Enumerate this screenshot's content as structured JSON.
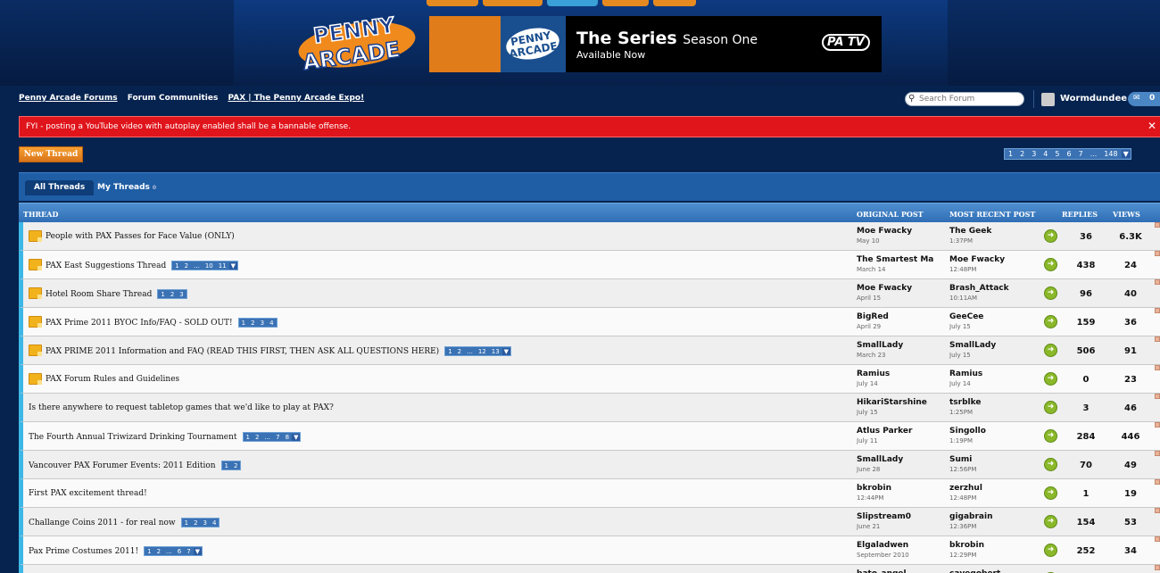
{
  "logo_text": "PENNY ARCADE",
  "banner": {
    "logo_text": "PENNY ARCADE",
    "title": "The Series",
    "title_suffix": "Season One",
    "subtitle": "Available Now",
    "network": "PA TV"
  },
  "breadcrumbs": [
    "Penny Arcade Forums",
    "Forum Communities",
    "PAX | The Penny Arcade Expo!"
  ],
  "search": {
    "placeholder": "Search Forum"
  },
  "user": {
    "name": "Wormdundee",
    "messages": "0"
  },
  "alert": {
    "text": "FYI - posting a YouTube video with autoplay enabled shall be a bannable offense.",
    "close": "✕"
  },
  "new_thread_label": "New Thread",
  "pager": [
    "1",
    "2",
    "3",
    "4",
    "5",
    "6",
    "7",
    "...",
    "148"
  ],
  "tabs": {
    "all": "All Threads",
    "mine": "My Threads",
    "mine_count": "0"
  },
  "columns": {
    "thread": "THREAD",
    "original": "ORIGINAL POST",
    "recent": "MOST RECENT POST",
    "replies": "REPLIES",
    "views": "VIEWS"
  },
  "threads": [
    {
      "sticky": true,
      "title": "People with PAX Passes for Face Value (ONLY)",
      "pages": [],
      "op": "Moe Fwacky",
      "op_date": "May 10",
      "last": "The Geek",
      "last_date": "1:37PM",
      "replies": "36",
      "views": "6.3K"
    },
    {
      "sticky": true,
      "title": "PAX East Suggestions Thread",
      "pages": [
        "1",
        "2",
        "...",
        "10",
        "11"
      ],
      "dropdown": true,
      "op": "The Smartest Ma",
      "op_date": "March 14",
      "last": "Moe Fwacky",
      "last_date": "12:48PM",
      "replies": "438",
      "views": "24"
    },
    {
      "sticky": true,
      "title": "Hotel Room Share Thread",
      "pages": [
        "1",
        "2",
        "3"
      ],
      "op": "Moe Fwacky",
      "op_date": "April 15",
      "last": "Brash_Attack",
      "last_date": "10:11AM",
      "replies": "96",
      "views": "40"
    },
    {
      "sticky": true,
      "title": "PAX Prime 2011 BYOC Info/FAQ - SOLD OUT!",
      "pages": [
        "1",
        "2",
        "3",
        "4"
      ],
      "op": "BigRed",
      "op_date": "April 29",
      "last": "GeeCee",
      "last_date": "July 15",
      "replies": "159",
      "views": "36"
    },
    {
      "sticky": true,
      "title": "PAX PRIME 2011 Information and FAQ (READ THIS FIRST, THEN ASK ALL QUESTIONS HERE)",
      "pages": [
        "1",
        "2",
        "...",
        "12",
        "13"
      ],
      "dropdown": true,
      "op": "SmallLady",
      "op_date": "March 23",
      "last": "SmallLady",
      "last_date": "July 15",
      "replies": "506",
      "views": "91"
    },
    {
      "sticky": true,
      "title": "PAX Forum Rules and Guidelines",
      "pages": [],
      "op": "Ramius",
      "op_date": "July 14",
      "last": "Ramius",
      "last_date": "July 14",
      "replies": "0",
      "views": "23"
    },
    {
      "sticky": false,
      "title": "Is there anywhere to request tabletop games that we'd like to play at PAX?",
      "pages": [],
      "op": "HikariStarshine",
      "op_date": "July 15",
      "last": "tsrblke",
      "last_date": "1:25PM",
      "replies": "3",
      "views": "46"
    },
    {
      "sticky": false,
      "title": "The Fourth Annual Triwizard Drinking Tournament",
      "pages": [
        "1",
        "2",
        "...",
        "7",
        "8"
      ],
      "dropdown": true,
      "op": "Atlus Parker",
      "op_date": "July 11",
      "last": "Singollo",
      "last_date": "1:19PM",
      "replies": "284",
      "views": "446"
    },
    {
      "sticky": false,
      "title": "Vancouver PAX Forumer Events: 2011 Edition",
      "pages": [
        "1",
        "2"
      ],
      "op": "SmallLady",
      "op_date": "June 28",
      "last": "Sumi",
      "last_date": "12:56PM",
      "replies": "70",
      "views": "49"
    },
    {
      "sticky": false,
      "title": "First PAX excitement thread!",
      "pages": [],
      "op": "bkrobin",
      "op_date": "12:44PM",
      "last": "zerzhul",
      "last_date": "12:48PM",
      "replies": "1",
      "views": "19"
    },
    {
      "sticky": false,
      "title": "Challange Coins 2011 - for real now",
      "pages": [
        "1",
        "2",
        "3",
        "4"
      ],
      "op": "Slipstream0",
      "op_date": "June 21",
      "last": "gigabrain",
      "last_date": "12:36PM",
      "replies": "154",
      "views": "53"
    },
    {
      "sticky": false,
      "title": "Pax Prime Costumes 2011!",
      "pages": [
        "1",
        "2",
        "...",
        "6",
        "7"
      ],
      "dropdown": true,
      "op": "Elgaladwen",
      "op_date": "September 2010",
      "last": "bkrobin",
      "last_date": "12:29PM",
      "replies": "252",
      "views": "34"
    },
    {
      "sticky": false,
      "title": "",
      "pages": [],
      "op": "bato_angel",
      "op_date": "",
      "last": "cavegobert",
      "last_date": "",
      "replies": "",
      "views": ""
    }
  ]
}
